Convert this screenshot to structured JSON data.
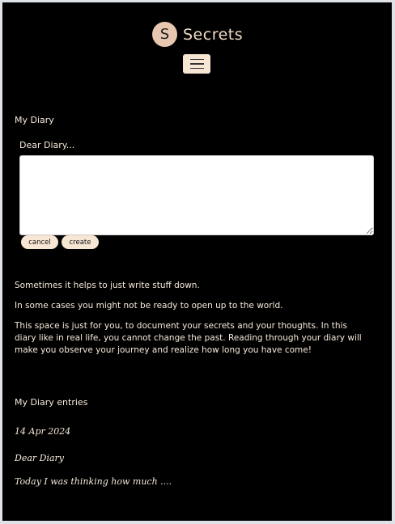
{
  "header": {
    "logo_letter": "S",
    "brand": "Secrets"
  },
  "diary": {
    "section_title": "My Diary",
    "textarea_label": "Dear Diary...",
    "cancel_label": "cancel",
    "create_label": "create"
  },
  "intro": [
    "Sometimes it helps to just write stuff down.",
    "In some cases you might not be ready to open up to the world.",
    "This space is just for you, to document your secrets and your thoughts. In this diary like in real life, you cannot change the past. Reading through your diary will make you observe your journey and realize how long you have come!"
  ],
  "entries": {
    "section_title": "My Diary entries",
    "items": [
      {
        "date": "14 Apr 2024",
        "greeting": "Dear Diary",
        "preview": "Today I was thinking how much ...."
      }
    ]
  }
}
